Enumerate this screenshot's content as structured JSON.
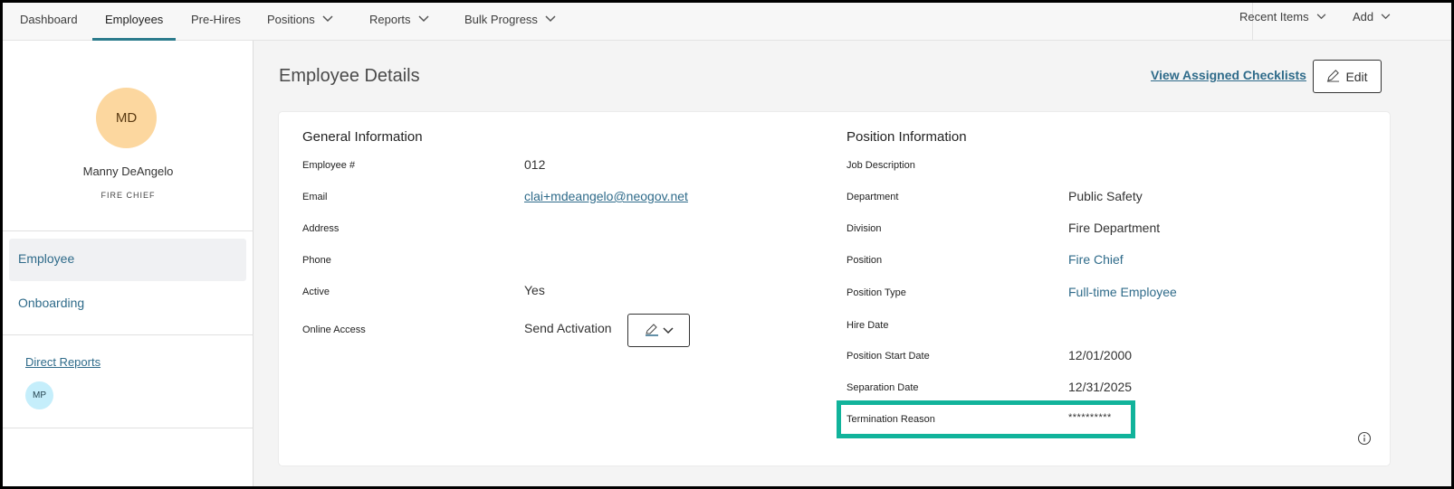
{
  "nav": {
    "items": [
      {
        "label": "Dashboard",
        "has_chevron": false
      },
      {
        "label": "Employees",
        "has_chevron": false,
        "active": true
      },
      {
        "label": "Pre-Hires",
        "has_chevron": false
      },
      {
        "label": "Positions",
        "has_chevron": true
      },
      {
        "label": "Reports",
        "has_chevron": true
      },
      {
        "label": "Bulk Progress",
        "has_chevron": true
      }
    ],
    "right": [
      {
        "label": "Recent Items",
        "has_chevron": true
      },
      {
        "label": "Add",
        "has_chevron": true
      }
    ]
  },
  "profile": {
    "initials": "MD",
    "name": "Manny DeAngelo",
    "title": "FIRE CHIEF"
  },
  "sidebar": {
    "items": [
      {
        "label": "Employee",
        "active": true
      },
      {
        "label": "Onboarding",
        "active": false
      }
    ],
    "direct_reports_label": "Direct Reports",
    "direct_reports": [
      {
        "initials": "MP"
      }
    ]
  },
  "page": {
    "title": "Employee Details",
    "checklists_link": "View Assigned Checklists",
    "edit_label": "Edit"
  },
  "general": {
    "title": "General Information",
    "fields": [
      {
        "label": "Employee #",
        "value": "012"
      },
      {
        "label": "Email",
        "value": "clai+mdeangelo@neogov.net"
      },
      {
        "label": "Address",
        "value": ""
      },
      {
        "label": "Phone",
        "value": ""
      },
      {
        "label": "Active",
        "value": "Yes"
      },
      {
        "label": "Online Access",
        "value": "Send Activation"
      }
    ]
  },
  "position": {
    "title": "Position Information",
    "fields": [
      {
        "label": "Job Description",
        "value": ""
      },
      {
        "label": "Department",
        "value": "Public Safety"
      },
      {
        "label": "Division",
        "value": "Fire Department"
      },
      {
        "label": "Position",
        "value": "Fire Chief"
      },
      {
        "label": "Position Type",
        "value": "Full-time Employee"
      },
      {
        "label": "Hire Date",
        "value": ""
      },
      {
        "label": "Position Start Date",
        "value": "12/01/2000"
      },
      {
        "label": "Separation Date",
        "value": "12/31/2025"
      },
      {
        "label": "Termination Reason",
        "value": "**********"
      }
    ]
  },
  "colors": {
    "accent": "#2b7b8c",
    "link": "#2f6b8a",
    "highlight": "#11b39b",
    "avatar_lg": "#fcd79f",
    "avatar_sm": "#c5eefb"
  }
}
